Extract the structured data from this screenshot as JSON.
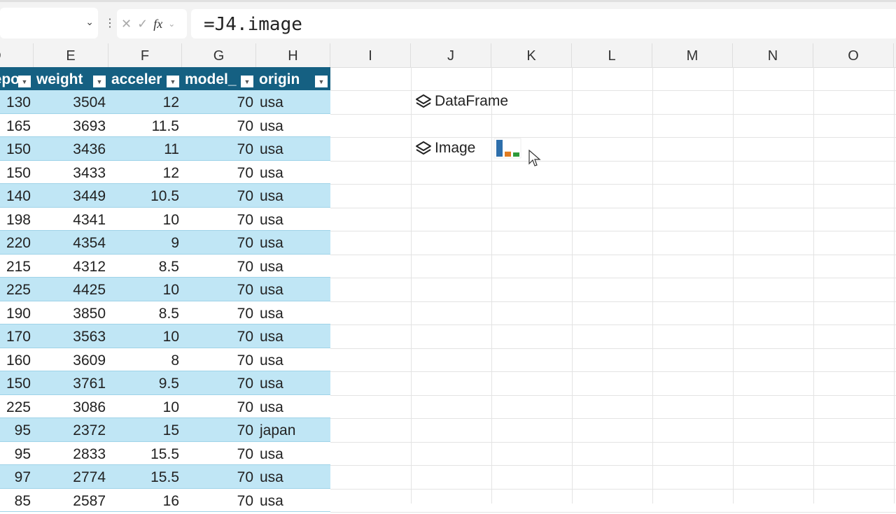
{
  "formula_bar": {
    "formula": "=J4.image",
    "fx_label": "fx",
    "cancel": "✕",
    "enter": "✓"
  },
  "columns": [
    "D",
    "E",
    "F",
    "G",
    "H",
    "I",
    "J",
    "K",
    "L",
    "M",
    "N",
    "O"
  ],
  "table": {
    "headers": [
      "horsepower",
      "weight",
      "acceleration",
      "model_year",
      "origin"
    ],
    "header_display": [
      "epo",
      "weight",
      "acceler",
      "model_",
      "origin"
    ],
    "rows": [
      [
        "130",
        "3504",
        "12",
        "70",
        "usa"
      ],
      [
        "165",
        "3693",
        "11.5",
        "70",
        "usa"
      ],
      [
        "150",
        "3436",
        "11",
        "70",
        "usa"
      ],
      [
        "150",
        "3433",
        "12",
        "70",
        "usa"
      ],
      [
        "140",
        "3449",
        "10.5",
        "70",
        "usa"
      ],
      [
        "198",
        "4341",
        "10",
        "70",
        "usa"
      ],
      [
        "220",
        "4354",
        "9",
        "70",
        "usa"
      ],
      [
        "215",
        "4312",
        "8.5",
        "70",
        "usa"
      ],
      [
        "225",
        "4425",
        "10",
        "70",
        "usa"
      ],
      [
        "190",
        "3850",
        "8.5",
        "70",
        "usa"
      ],
      [
        "170",
        "3563",
        "10",
        "70",
        "usa"
      ],
      [
        "160",
        "3609",
        "8",
        "70",
        "usa"
      ],
      [
        "150",
        "3761",
        "9.5",
        "70",
        "usa"
      ],
      [
        "225",
        "3086",
        "10",
        "70",
        "usa"
      ],
      [
        "95",
        "2372",
        "15",
        "70",
        "japan"
      ],
      [
        "95",
        "2833",
        "15.5",
        "70",
        "usa"
      ],
      [
        "97",
        "2774",
        "15.5",
        "70",
        "usa"
      ],
      [
        "85",
        "2587",
        "16",
        "70",
        "usa"
      ]
    ]
  },
  "objects": {
    "dataframe_label": "DataFrame",
    "image_label": "Image"
  },
  "thumbnail": {
    "bar_colors": [
      "#2e6fab",
      "#e07b20",
      "#2e9a3a"
    ],
    "values": [
      1,
      0.3,
      0.25
    ]
  }
}
